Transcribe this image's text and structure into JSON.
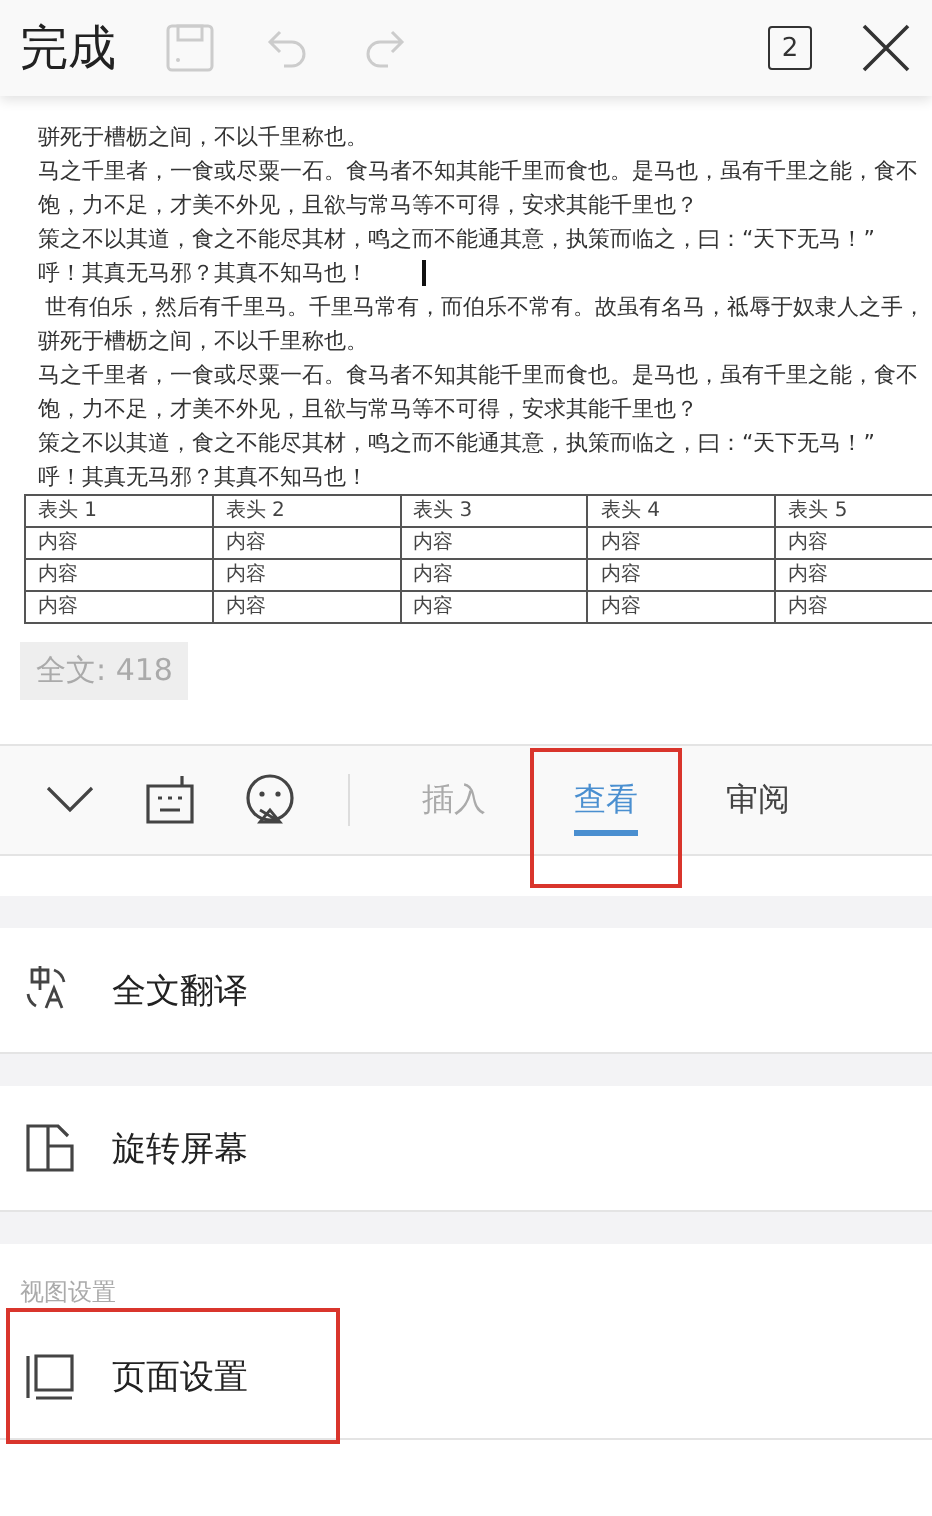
{
  "toolbar": {
    "done": "完成",
    "page_count": "2"
  },
  "document": {
    "lines": [
      "骈死于槽枥之间，不以千里称也。",
      "马之千里者，一食或尽粟一石。食马者不知其能千里而食也。是马也，虽有千里之能，食不",
      "饱，力不足，才美不外见，且欲与常马等不可得，安求其能千里也？",
      "策之不以其道，食之不能尽其材，鸣之而不能通其意，执策而临之，曰：“天下无马！”",
      "呼！其真无马邪？其真不知马也！",
      " 世有伯乐，然后有千里马。千里马常有，而伯乐不常有。故虽有名马，祗辱于奴隶人之手，",
      "骈死于槽枥之间，不以千里称也。",
      "马之千里者，一食或尽粟一石。食马者不知其能千里而食也。是马也，虽有千里之能，食不",
      "饱，力不足，才美不外见，且欲与常马等不可得，安求其能千里也？",
      "策之不以其道，食之不能尽其材，鸣之而不能通其意，执策而临之，曰：“天下无马！”",
      "呼！其真无马邪？其真不知马也！"
    ],
    "table": {
      "columns": [
        "表头 1",
        "表头 2",
        "表头 3",
        "表头 4",
        "表头 5"
      ],
      "rows": [
        [
          "内容",
          "内容",
          "内容",
          "内容",
          "内容"
        ],
        [
          "内容",
          "内容",
          "内容",
          "内容",
          "内容"
        ],
        [
          "内容",
          "内容",
          "内容",
          "内容",
          "内容"
        ]
      ]
    }
  },
  "word_count": "全文: 418",
  "tabs": [
    {
      "label": "插入",
      "selected": false,
      "highlighted": false
    },
    {
      "label": "查看",
      "selected": true,
      "highlighted": true
    },
    {
      "label": "审阅",
      "selected": false,
      "highlighted": false
    }
  ],
  "menu": [
    {
      "kind": "item",
      "label": "全文翻译",
      "highlighted": false
    },
    {
      "kind": "item",
      "label": "旋转屏幕",
      "highlighted": false
    },
    {
      "kind": "header",
      "label": "视图设置"
    },
    {
      "kind": "item",
      "label": "页面设置",
      "highlighted": true
    }
  ]
}
